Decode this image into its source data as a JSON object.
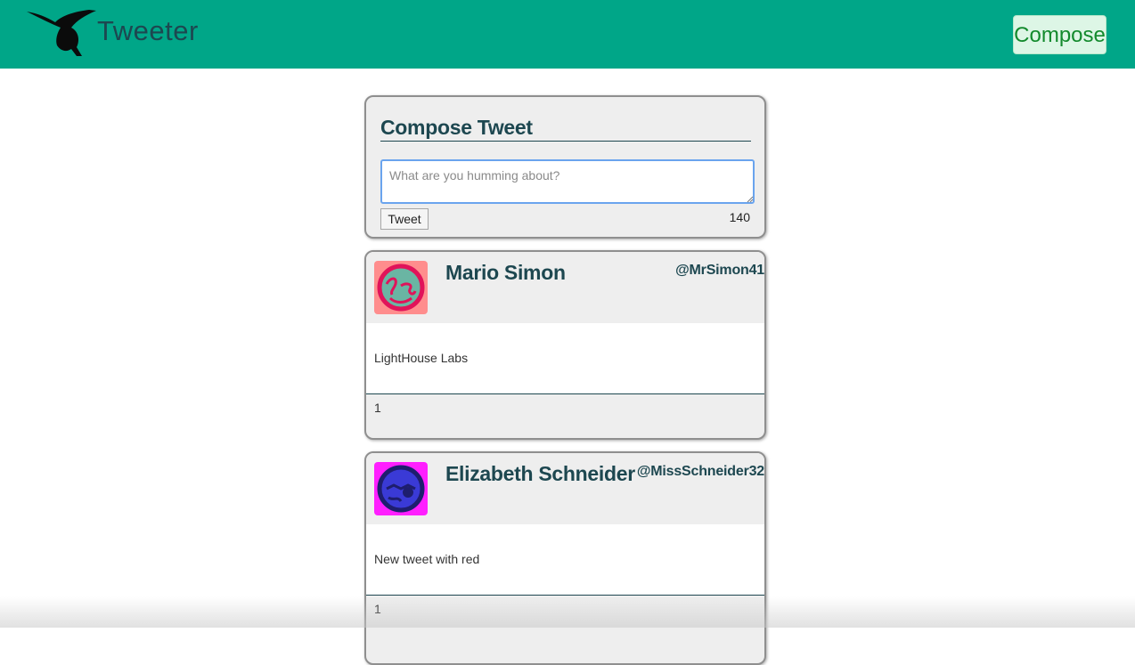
{
  "header": {
    "brand": "Tweeter",
    "compose_label": "Compose",
    "logo_icon": "hummingbird-icon",
    "bg_color": "#00a688"
  },
  "compose": {
    "title": "Compose Tweet",
    "placeholder": "What are you humming about?",
    "button_label": "Tweet",
    "counter": "140"
  },
  "tweets": [
    {
      "name": "Mario Simon",
      "handle": "@MrSimon41",
      "text": "LightHouse Labs",
      "footer": "1",
      "avatar_icon": "avatar-face-icon",
      "avatar_bg": "#ff8d8d"
    },
    {
      "name": "Elizabeth Schneider",
      "handle": "@MissSchneider32",
      "text": "New tweet with red",
      "footer": "1",
      "avatar_icon": "avatar-face-icon",
      "avatar_bg": "#ff1fff"
    }
  ]
}
